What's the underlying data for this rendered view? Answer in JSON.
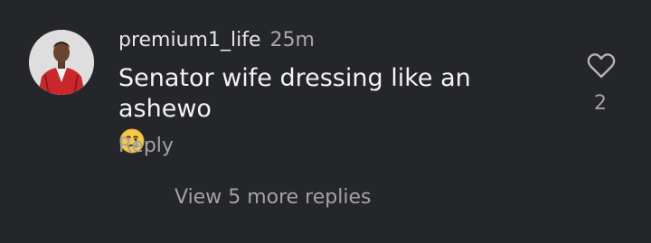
{
  "comment": {
    "username": "premium1_life",
    "time_ago": "25m",
    "text": "Senator wife dressing like an ashewo",
    "emoji": "crying-face-emoji",
    "like_count": "2",
    "reply_label": "Reply",
    "view_replies_label": "View 5 more replies"
  },
  "colors": {
    "background": "#242629",
    "primary_text": "#f3f3f3",
    "secondary_text": "#a3a3a3",
    "emoji_yellow": "#f7c948",
    "tear_blue": "#5aa9e6"
  },
  "icons": {
    "like": "heart-outline-icon",
    "avatar": "user-avatar-photo"
  }
}
